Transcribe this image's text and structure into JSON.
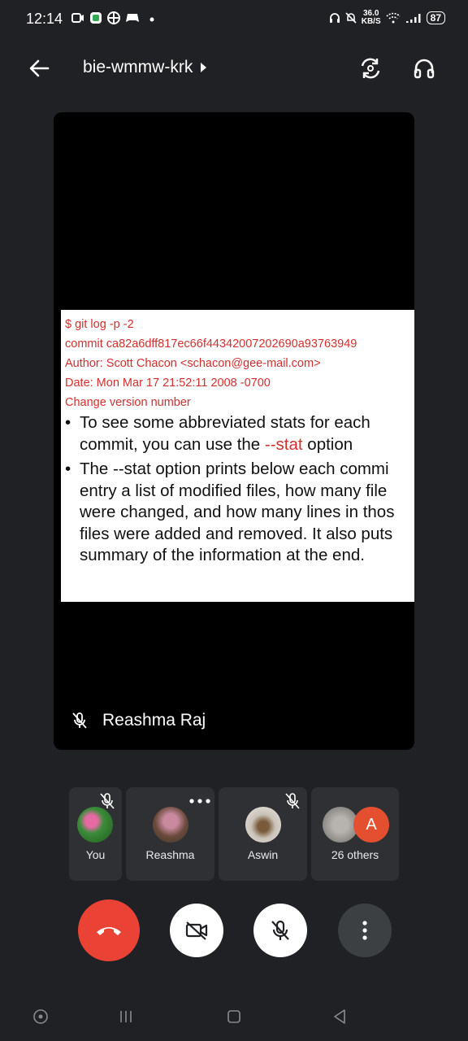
{
  "status_bar": {
    "time": "12:14",
    "speed_value": "36.0",
    "speed_unit": "KB/S",
    "battery": "87"
  },
  "header": {
    "meeting_code": "bie-wmmw-krk",
    "icons": [
      "back-arrow-icon",
      "play-triangle-icon",
      "switch-camera-icon",
      "headphones-icon"
    ]
  },
  "main_tile": {
    "presenter_name": "Reashma Raj",
    "slide": {
      "code_lines": [
        "$ git log -p -2",
        "commit ca82a6dff817ec66f44342007202690a93763949",
        "Author: Scott Chacon <schacon@gee-mail.com>",
        "Date: Mon Mar 17 21:52:11 2008 -0700",
        "Change version number"
      ],
      "bullet1_line1": "To see some abbreviated stats for each",
      "bullet1_line2_pre": "commit, you can use the ",
      "bullet1_line2_highlight": "--stat",
      "bullet1_line2_post": " option",
      "bullet2_lines": [
        "The --stat option prints below each commi",
        "entry a list of modified files, how many file",
        "were changed, and how many lines in thos",
        "files were added and removed. It also puts",
        "summary of the information at the end."
      ]
    }
  },
  "participants": [
    {
      "name": "You",
      "muted": true
    },
    {
      "name": "Reashma",
      "muted": false
    },
    {
      "name": "Aswin",
      "muted": true
    },
    {
      "name": "26 others",
      "initial": "A"
    }
  ],
  "colors": {
    "background": "#202124",
    "tile": "#2f3033",
    "end_call": "#ea4335",
    "avatar_orange": "#e4502f"
  }
}
